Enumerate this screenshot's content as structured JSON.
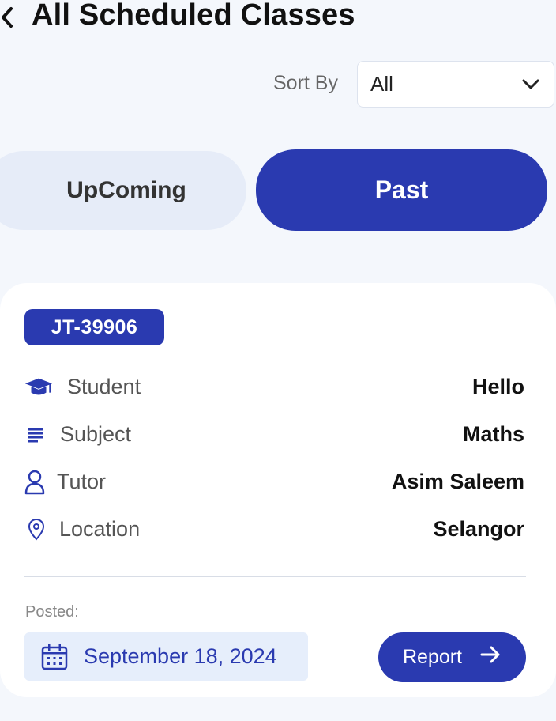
{
  "header": {
    "title": "All Scheduled Classes",
    "back_icon": "chevron-left-icon"
  },
  "sort": {
    "label": "Sort By",
    "selected": "All",
    "icon": "chevron-down-icon"
  },
  "tabs": [
    {
      "label": "UpComing",
      "active": false
    },
    {
      "label": "Past",
      "active": true
    }
  ],
  "card": {
    "code": "JT-39906",
    "rows": [
      {
        "icon": "graduation-cap-icon",
        "label": "Student",
        "value": "Hello"
      },
      {
        "icon": "lines-icon",
        "label": "Subject",
        "value": "Maths"
      },
      {
        "icon": "person-icon",
        "label": "Tutor",
        "value": "Asim Saleem"
      },
      {
        "icon": "location-pin-icon",
        "label": "Location",
        "value": "Selangor"
      }
    ],
    "posted_label": "Posted:",
    "date": "September 18, 2024",
    "report_label": "Report"
  },
  "colors": {
    "accent": "#2a3ab0",
    "background": "#f4f7fc",
    "tab_inactive": "#e6ecf8",
    "chip_bg": "#e6eefb"
  }
}
